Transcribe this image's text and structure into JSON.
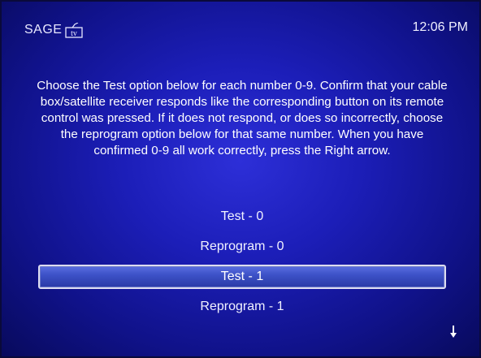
{
  "header": {
    "logo_text": "SAGE",
    "clock": "12:06 PM"
  },
  "instructions": "Choose the Test option below for each number 0-9. Confirm that your cable box/satellite receiver responds like the corresponding button on its remote control was pressed. If it does not respond, or does so incorrectly, choose the reprogram option below for that same number. When you have confirmed 0-9 all work correctly, press the Right arrow.",
  "options": [
    {
      "label": "Test - 0",
      "selected": false
    },
    {
      "label": "Reprogram - 0",
      "selected": false
    },
    {
      "label": "Test - 1",
      "selected": true
    },
    {
      "label": "Reprogram - 1",
      "selected": false
    }
  ],
  "icons": {
    "logo": "sage-tv-logo-icon",
    "scroll": "arrow-down-icon"
  },
  "colors": {
    "background": "#1c1eb8",
    "selected_row": "#3d52c8",
    "text": "#ffffff"
  }
}
